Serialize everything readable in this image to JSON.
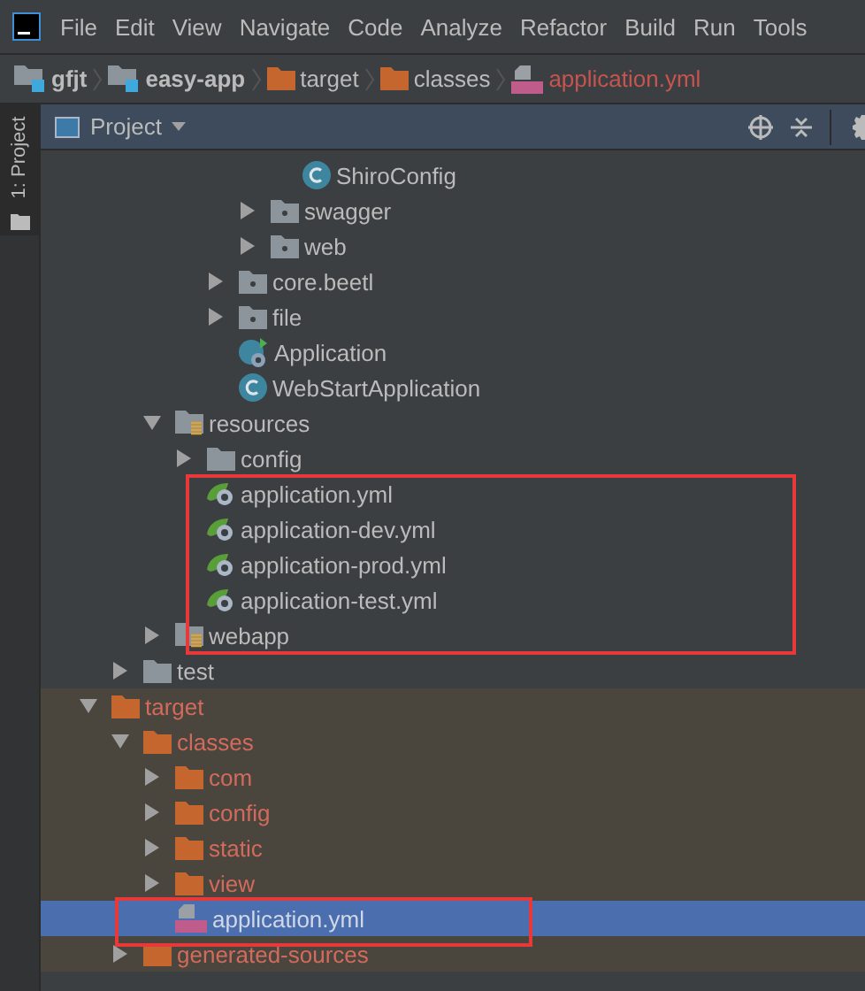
{
  "menu": [
    "File",
    "Edit",
    "View",
    "Navigate",
    "Code",
    "Analyze",
    "Refactor",
    "Build",
    "Run",
    "Tools"
  ],
  "breadcrumb": [
    {
      "label": "gfjt",
      "kind": "module"
    },
    {
      "label": "easy-app",
      "kind": "module"
    },
    {
      "label": "target",
      "kind": "excluded-folder"
    },
    {
      "label": "classes",
      "kind": "excluded-folder"
    },
    {
      "label": "application.yml",
      "kind": "yml"
    }
  ],
  "side_tab": "1: Project",
  "panel": {
    "title": "Project"
  },
  "tree": [
    {
      "children": [
        {
          "children": [
            {
              "children": [
                {
                  "children": [
                    {
                      "children": [
                        {
                          "children": [
                            {
                              "label": "ShiroConfig",
                              "kind": "class"
                            }
                          ]
                        },
                        {
                          "label": "swagger",
                          "kind": "package",
                          "expanded": false
                        },
                        {
                          "label": "web",
                          "kind": "package",
                          "expanded": false
                        }
                      ]
                    },
                    {
                      "label": "core.beetl",
                      "kind": "package",
                      "expanded": false
                    },
                    {
                      "label": "file",
                      "kind": "package",
                      "expanded": false
                    },
                    {
                      "label": "Application",
                      "kind": "spring-class"
                    },
                    {
                      "label": "WebStartApplication",
                      "kind": "class"
                    }
                  ]
                }
              ]
            },
            {
              "label": "resources",
              "kind": "resources",
              "expanded": true,
              "children": [
                {
                  "label": "config",
                  "kind": "folder",
                  "expanded": false
                },
                {
                  "label": "application.yml",
                  "kind": "spring-yml"
                },
                {
                  "label": "application-dev.yml",
                  "kind": "spring-yml"
                },
                {
                  "label": "application-prod.yml",
                  "kind": "spring-yml"
                },
                {
                  "label": "application-test.yml",
                  "kind": "spring-yml"
                }
              ]
            },
            {
              "label": "webapp",
              "kind": "resources",
              "expanded": false
            }
          ]
        },
        {
          "label": "test",
          "kind": "folder",
          "expanded": false
        }
      ]
    },
    {
      "label": "target",
      "kind": "folder",
      "expanded": true,
      "excluded": true,
      "children": [
        {
          "label": "classes",
          "kind": "folder",
          "expanded": true,
          "children": [
            {
              "label": "com",
              "kind": "folder",
              "expanded": false
            },
            {
              "label": "config",
              "kind": "folder",
              "expanded": false
            },
            {
              "label": "static",
              "kind": "folder",
              "expanded": false
            },
            {
              "label": "view",
              "kind": "folder",
              "expanded": false
            },
            {
              "label": "application.yml",
              "kind": "yml",
              "selected": true
            }
          ]
        },
        {
          "label": "generated-sources",
          "kind": "folder",
          "expanded": false
        }
      ]
    }
  ]
}
